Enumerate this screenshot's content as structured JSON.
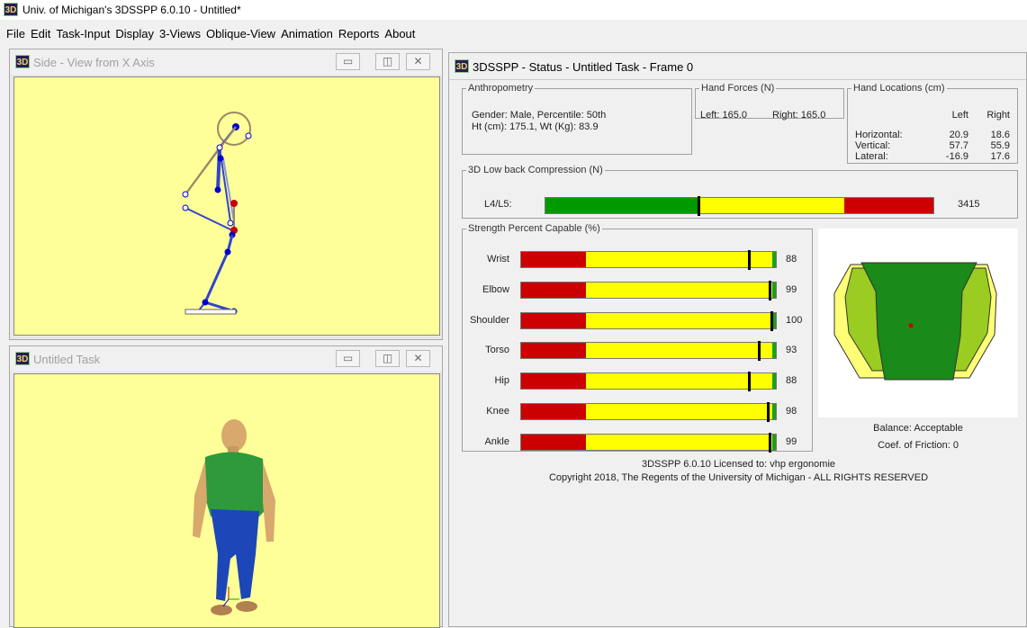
{
  "app": {
    "icon_text": "3D",
    "title": "Univ. of Michigan's 3DSSPP 6.0.10 - Untitled*"
  },
  "menu": [
    "File",
    "Edit",
    "Task-Input",
    "Display",
    "3-Views",
    "Oblique-View",
    "Animation",
    "Reports",
    "About"
  ],
  "side_view": {
    "title": "Side - View from X Axis"
  },
  "task_view": {
    "title": "Untitled Task"
  },
  "status": {
    "title": "3DSSPP - Status - Untitled Task - Frame 0",
    "anthropometry": {
      "legend": "Anthropometry",
      "line1": "Gender: Male, Percentile: 50th",
      "line2": "Ht (cm): 175.1, Wt (Kg): 83.9"
    },
    "hand_forces": {
      "legend": "Hand Forces (N)",
      "left": "Left: 165.0",
      "right": "Right: 165.0"
    },
    "hand_locations": {
      "legend": "Hand Locations (cm)",
      "col_left": "Left",
      "col_right": "Right",
      "rows": [
        {
          "label": "Horizontal:",
          "left": "20.9",
          "right": "18.6"
        },
        {
          "label": "Vertical:",
          "left": "57.7",
          "right": "55.9"
        },
        {
          "label": "Lateral:",
          "left": "-16.9",
          "right": "17.6"
        }
      ]
    },
    "low_back": {
      "legend": "3D Low back Compression (N)",
      "label": "L4/L5:",
      "value": "3415",
      "fraction": 0.4
    },
    "strength": {
      "legend": "Strength Percent Capable (%)",
      "rows": [
        {
          "label": "Wrist",
          "value": "88",
          "pct": 88
        },
        {
          "label": "Elbow",
          "value": "99",
          "pct": 99
        },
        {
          "label": "Shoulder",
          "value": "100",
          "pct": 100
        },
        {
          "label": "Torso",
          "value": "93",
          "pct": 93
        },
        {
          "label": "Hip",
          "value": "88",
          "pct": 88
        },
        {
          "label": "Knee",
          "value": "98",
          "pct": 98
        },
        {
          "label": "Ankle",
          "value": "99",
          "pct": 99
        }
      ]
    },
    "balance": "Balance: Acceptable",
    "friction": "Coef. of Friction:  0",
    "license": "3DSSPP 6.0.10 Licensed to: vhp ergonomie",
    "copyright": "Copyright 2018, The Regents of the University of Michigan - ALL RIGHTS RESERVED"
  },
  "colors": {
    "red": "#cc0000",
    "yellow": "#ffff00",
    "green": "#009900",
    "viewport": "#ffff99"
  }
}
